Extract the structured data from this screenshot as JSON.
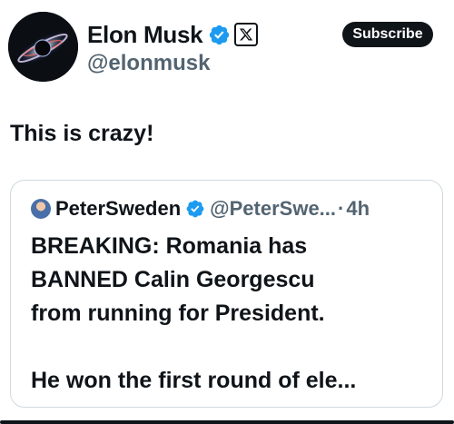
{
  "author": {
    "display_name": "Elon Musk",
    "handle": "@elonmusk",
    "verified": true,
    "affiliate_badge": "x-logo-icon",
    "avatar": "galaxy-avatar"
  },
  "actions": {
    "subscribe_label": "Subscribe"
  },
  "post": {
    "text": "This is crazy!"
  },
  "quote": {
    "author_name": "PeterSweden",
    "author_handle": "@PeterSwe...",
    "separator": "·",
    "time": "4h",
    "verified": true,
    "lines": [
      "BREAKING: Romania has",
      "BANNED Calin Georgescu",
      "from running for President.",
      "He won the first round of ele..."
    ]
  },
  "colors": {
    "text_primary": "#0f1419",
    "text_secondary": "#536471",
    "verified_blue": "#1d9bf0",
    "border": "#cfd9de",
    "button_bg": "#0f1419"
  }
}
